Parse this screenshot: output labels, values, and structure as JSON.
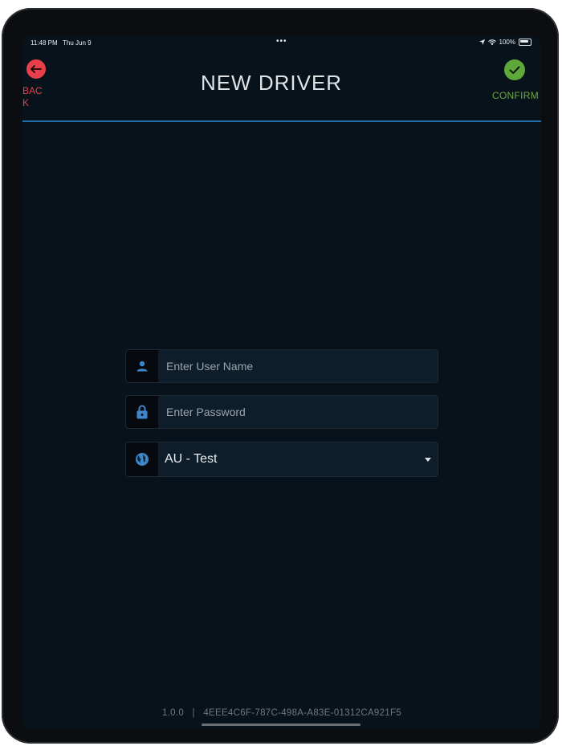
{
  "status_bar": {
    "time": "11:48 PM",
    "date": "Thu Jun 9",
    "dots": "•••",
    "battery": "100%"
  },
  "header": {
    "back_label": "BACK",
    "title": "NEW DRIVER",
    "confirm_label": "CONFIRM"
  },
  "form": {
    "username": {
      "value": "",
      "placeholder": "Enter User Name"
    },
    "password": {
      "value": "",
      "placeholder": "Enter Password"
    },
    "region": {
      "selected": "AU - Test"
    }
  },
  "footer": {
    "version": "1.0.0",
    "separator": "|",
    "device_id": "4EEE4C6F-787C-498A-A83E-01312CA921F5"
  },
  "icons": {
    "back": "arrow-left-icon",
    "confirm": "check-icon",
    "username": "person-icon",
    "password": "lock-icon",
    "region": "globe-icon",
    "dropdown": "caret-down-icon"
  },
  "colors": {
    "background": "#07121a",
    "accent_line": "#1f6fa8",
    "back": "#e8404a",
    "confirm": "#5fa83b",
    "field_icon": "#3f86c8"
  }
}
